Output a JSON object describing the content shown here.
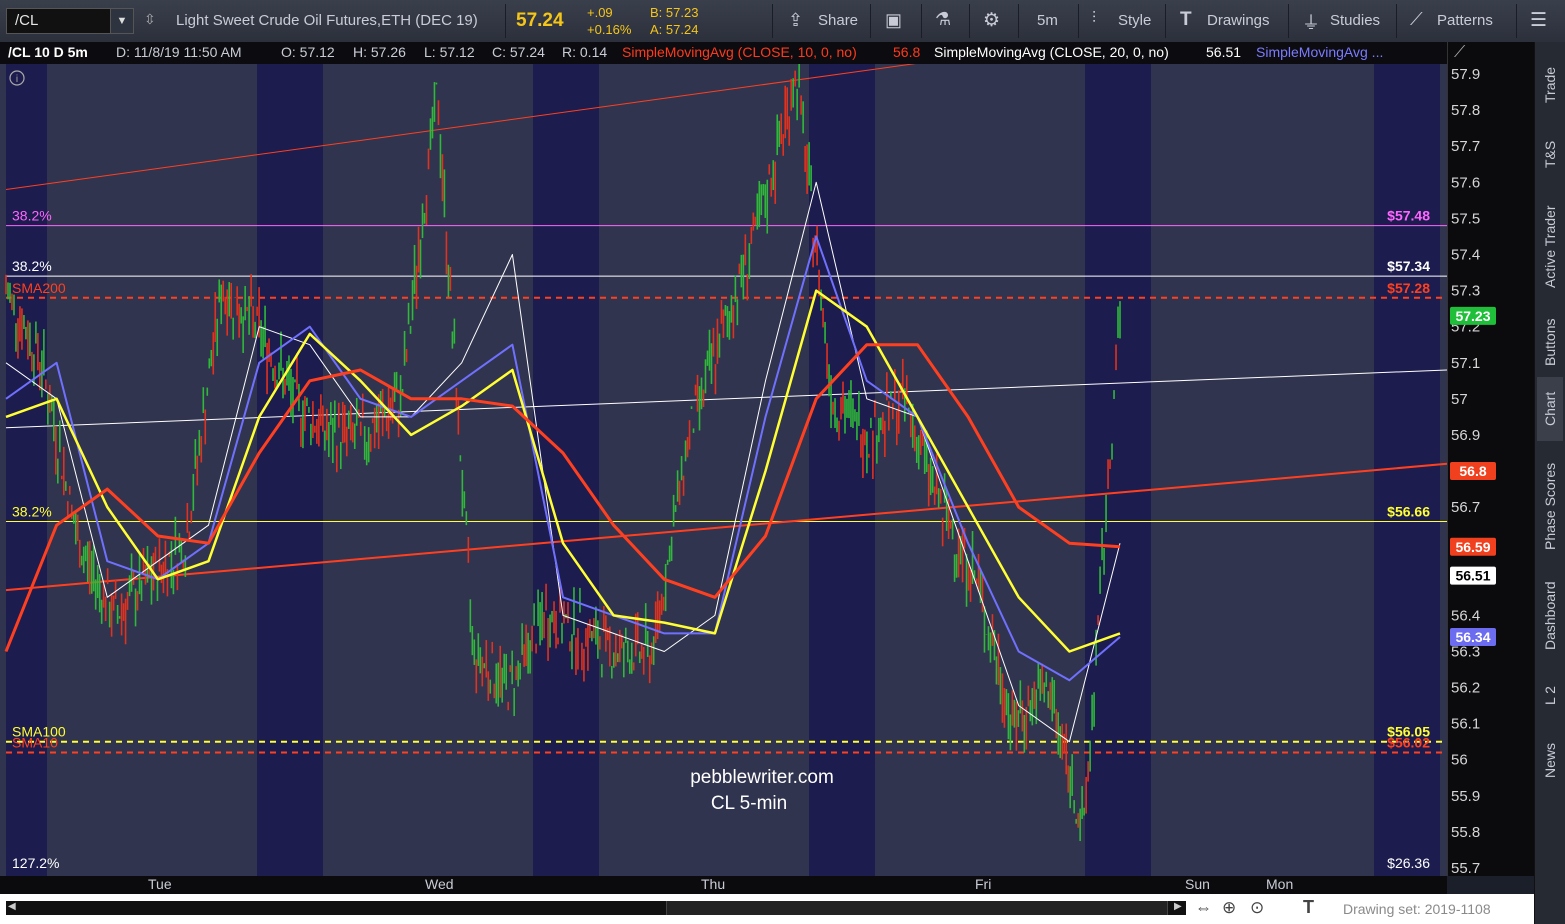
{
  "toolbar": {
    "symbol": "/CL",
    "description": "Light Sweet Crude Oil Futures,ETH (DEC 19)",
    "last": "57.24",
    "change": "+.09",
    "change_pct": "+0.16%",
    "bid": "B: 57.23",
    "ask": "A: 57.24",
    "share": "Share",
    "interval": "5m",
    "style": "Style",
    "drawings": "Drawings",
    "studies": "Studies",
    "patterns": "Patterns"
  },
  "info_bar": {
    "symbol": "/CL 10 D 5m",
    "date": "D: 11/8/19 11:50 AM",
    "open": "O: 57.12",
    "high": "H: 57.26",
    "low": "L: 57.12",
    "close": "C: 57.24",
    "range": "R: 0.14",
    "sma10": "SimpleMovingAvg (CLOSE, 10, 0, no)",
    "sma10_value": "56.8",
    "sma20": "SimpleMovingAvg (CLOSE, 20, 0, no)",
    "sma20_value": "56.51",
    "sma_more": "SimpleMovingAvg ..."
  },
  "price_axis": {
    "ticks": [
      "57.9",
      "57.8",
      "57.7",
      "57.6",
      "57.5",
      "57.4",
      "57.3",
      "57.2",
      "57.1",
      "57",
      "56.9",
      "56.8",
      "56.7",
      "56.6",
      "56.5",
      "56.4",
      "56.3",
      "56.2",
      "56.1",
      "56",
      "55.9",
      "55.8",
      "55.7"
    ],
    "badges": [
      {
        "text": "57.23",
        "price": 57.23,
        "bg": "#1fbf3a",
        "fg": "#ffffff"
      },
      {
        "text": "56.8",
        "price": 56.8,
        "bg": "#f0401e",
        "fg": "#ffffff"
      },
      {
        "text": "56.59",
        "price": 56.59,
        "bg": "#f0401e",
        "fg": "#ffffff"
      },
      {
        "text": "56.51",
        "price": 56.51,
        "bg": "#ffffff",
        "fg": "#000000"
      },
      {
        "text": "56.34",
        "price": 56.34,
        "bg": "#6c6cf0",
        "fg": "#ffffff"
      }
    ]
  },
  "levels": [
    {
      "left": "38.2%",
      "right": "$57.48",
      "price": 57.48,
      "color": "#ff66ff",
      "dash": false
    },
    {
      "left": "38.2%",
      "right": "$57.34",
      "price": 57.34,
      "color": "#ffffff",
      "dash": false
    },
    {
      "left": "SMA200",
      "right": "$57.28",
      "price": 57.28,
      "color": "#ff4020",
      "dash": true
    },
    {
      "left": "38.2%",
      "right": "$56.66",
      "price": 56.66,
      "color": "#ffff33",
      "dash": false
    },
    {
      "left": "SMA100",
      "right": "$56.05",
      "price": 56.05,
      "color": "#ffff33",
      "dash": true
    },
    {
      "left": "SMA10",
      "right": "$56.02",
      "price": 56.02,
      "color": "#ff4020",
      "dash": true
    }
  ],
  "bottom_labels": {
    "left": "127.2%",
    "right": "$26.36"
  },
  "watermark": {
    "line1": "pebblewriter.com",
    "line2": "CL 5-min"
  },
  "days": [
    "Tue",
    "Wed",
    "Thu",
    "Fri",
    "Sun",
    "Mon"
  ],
  "right_tabs": [
    "Trade",
    "T&S",
    "Active Trader",
    "Buttons",
    "Chart",
    "Phase Scores",
    "Dashboard",
    "L 2",
    "News"
  ],
  "status": {
    "drawing_set": "Drawing set: 2019-1108"
  },
  "colors": {
    "bg": "#30344f",
    "session": "#1c1c4e",
    "sma10": "#ffffff",
    "sma20": "#7070ff",
    "sma50": "#ffff33",
    "sma100": "#ff4020"
  },
  "chart_data": {
    "type": "line",
    "x_categories": [
      "Tue",
      "Wed",
      "Thu",
      "Fri",
      "Sun",
      "Mon"
    ],
    "ylim": [
      55.7,
      57.95
    ],
    "series": [
      {
        "color": "#ffffff",
        "values": [
          57.1,
          57.0,
          56.45,
          56.55,
          56.65,
          57.2,
          57.15,
          56.95,
          56.95,
          57.1,
          57.4,
          56.4,
          56.35,
          56.3,
          56.4,
          57.05,
          57.6,
          57.0,
          56.95,
          56.55,
          56.15,
          56.05,
          56.6
        ]
      },
      {
        "color": "#7070ff",
        "values": [
          57.0,
          57.1,
          56.55,
          56.5,
          56.6,
          57.1,
          57.2,
          57.0,
          56.95,
          57.05,
          57.15,
          56.45,
          56.4,
          56.35,
          56.35,
          56.95,
          57.45,
          57.05,
          56.95,
          56.6,
          56.3,
          56.22,
          56.34
        ]
      },
      {
        "color": "#ffff33",
        "values": [
          56.95,
          57.0,
          56.7,
          56.5,
          56.55,
          56.95,
          57.18,
          57.05,
          56.9,
          56.98,
          57.08,
          56.6,
          56.4,
          56.38,
          56.35,
          56.8,
          57.3,
          57.2,
          56.95,
          56.7,
          56.45,
          56.3,
          56.35
        ]
      },
      {
        "color": "#ff4020",
        "values": [
          56.3,
          56.65,
          56.75,
          56.62,
          56.6,
          56.85,
          57.05,
          57.08,
          57.0,
          57.0,
          56.98,
          56.85,
          56.65,
          56.5,
          56.45,
          56.62,
          57.0,
          57.15,
          57.15,
          56.95,
          56.7,
          56.6,
          56.59
        ]
      }
    ],
    "trendlines": [
      {
        "color": "#ff4020",
        "from": 57.58,
        "to": 57.95
      },
      {
        "color": "#ffffff",
        "from": 56.92,
        "to": 57.08
      },
      {
        "color": "#ff4020",
        "from": 56.47,
        "to": 56.82
      }
    ],
    "candles": [
      57.3,
      57.1,
      56.6,
      56.4,
      56.5,
      56.6,
      57.3,
      57.2,
      57.0,
      56.9,
      56.9,
      57.0,
      57.85,
      56.3,
      56.2,
      56.4,
      56.35,
      56.3,
      56.3,
      56.9,
      57.2,
      57.5,
      57.9,
      57.0,
      56.9,
      57.0,
      56.7,
      56.5,
      56.1,
      56.2,
      55.8,
      57.24
    ]
  }
}
